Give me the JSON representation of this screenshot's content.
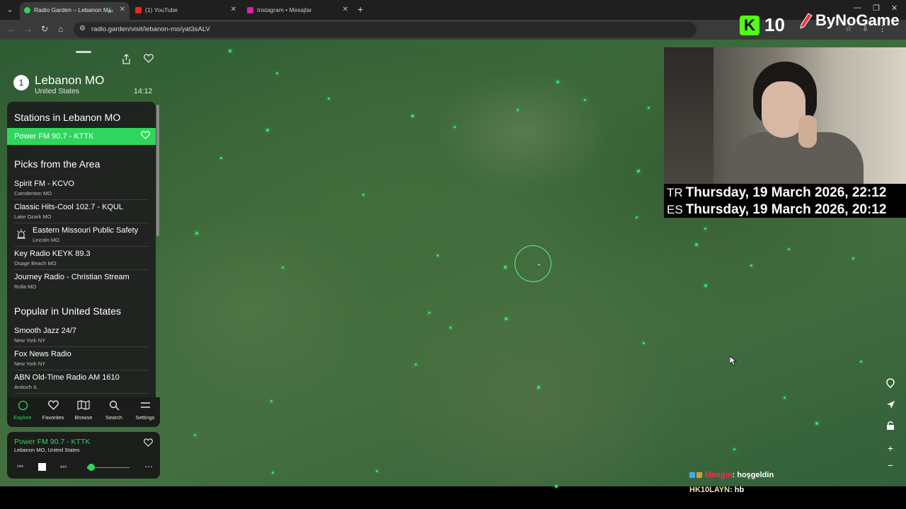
{
  "browser": {
    "tabs": [
      {
        "title": "Radio Garden – Lebanon M",
        "active": true
      },
      {
        "title": "(1) YouTube",
        "active": false
      },
      {
        "title": "Instagram • Mesajlar",
        "active": false
      }
    ],
    "url": "radio.garden/visit/lebanon-mo/yat3sALV"
  },
  "place": {
    "number": "1",
    "name": "Lebanon MO",
    "country": "United States",
    "time": "14:12"
  },
  "stations_section": {
    "title": "Stations in Lebanon MO",
    "active_station": "Power FM 90.7 - KTTK"
  },
  "picks_section": {
    "title": "Picks from the Area",
    "items": [
      {
        "name": "Spirit FM - KCVO",
        "location": "Camdenton MO"
      },
      {
        "name": "Classic Hits-Cool 102.7 - KQUL",
        "location": "Lake Ozark MO"
      },
      {
        "name": "Eastern Missouri Public Safety",
        "location": "Lincoln MO"
      },
      {
        "name": "Key Radio KEYK 89.3",
        "location": "Osage Beach MO"
      },
      {
        "name": "Journey Radio - Christian Stream",
        "location": "Rolla MO"
      }
    ]
  },
  "popular_section": {
    "title": "Popular in United States",
    "items": [
      {
        "name": "Smooth Jazz 24/7",
        "location": "New York NY"
      },
      {
        "name": "Fox News Radio",
        "location": "New York NY"
      },
      {
        "name": "ABN Old-Time Radio AM 1610",
        "location": "Antioch IL"
      }
    ]
  },
  "bottom_nav": [
    {
      "label": "Explore",
      "icon": "explore-icon"
    },
    {
      "label": "Favorites",
      "icon": "heart-icon"
    },
    {
      "label": "Browse",
      "icon": "map-icon"
    },
    {
      "label": "Search",
      "icon": "search-icon"
    },
    {
      "label": "Settings",
      "icon": "menu-icon"
    }
  ],
  "player": {
    "title": "Power FM 90.7 - KTTK",
    "subtitle": "Lebanon MO, United States",
    "volume": 0.1
  },
  "overlay": {
    "k_badge": "K",
    "viewer_count": "10",
    "brand": "ByNoGame",
    "dates": [
      {
        "code": "TR",
        "text": "Thursday, 19 March 2026, 22:12"
      },
      {
        "code": "ES",
        "text": "Thursday, 19 March 2026, 20:12"
      }
    ],
    "chat": [
      {
        "user": "lilengin",
        "message": ": hoşgeldin",
        "user_color": "#e8394b"
      },
      {
        "user": "HK10LAYN",
        "message": ": hb",
        "user_color": "#f2e6b0"
      }
    ]
  },
  "colors": {
    "accent": "#2fd65d",
    "kick_green": "#53fc18"
  }
}
